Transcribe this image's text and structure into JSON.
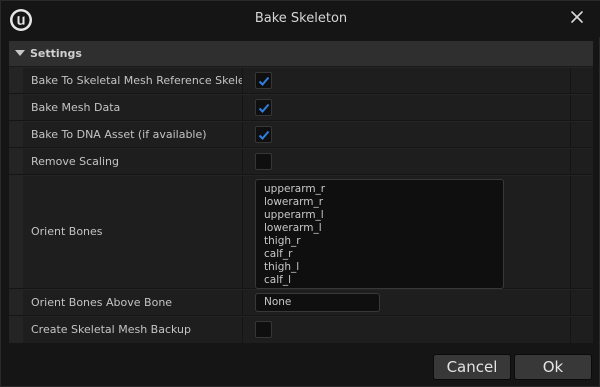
{
  "window": {
    "title": "Bake Skeleton"
  },
  "section": {
    "title": "Settings"
  },
  "rows": [
    {
      "label": "Bake To Skeletal Mesh Reference Skele...",
      "checked": true
    },
    {
      "label": "Bake Mesh Data",
      "checked": true
    },
    {
      "label": "Bake To DNA Asset (if available)",
      "checked": true
    },
    {
      "label": "Remove Scaling",
      "checked": false
    }
  ],
  "orient_bones": {
    "label": "Orient Bones",
    "items": [
      "upperarm_r",
      "lowerarm_r",
      "upperarm_l",
      "lowerarm_l",
      "thigh_r",
      "calf_r",
      "thigh_l",
      "calf_l"
    ]
  },
  "orient_above": {
    "label": "Orient Bones Above Bone",
    "value": "None"
  },
  "backup": {
    "label": "Create Skeletal Mesh Backup",
    "checked": false
  },
  "buttons": {
    "cancel": "Cancel",
    "ok": "Ok"
  },
  "colors": {
    "check": "#2f7fe0",
    "background": "#151515",
    "row": "#1e1e1e"
  },
  "icons": {
    "logo": "unreal-logo-icon",
    "close": "close-icon",
    "check": "checkmark-icon",
    "collapse": "triangle-down-icon"
  }
}
